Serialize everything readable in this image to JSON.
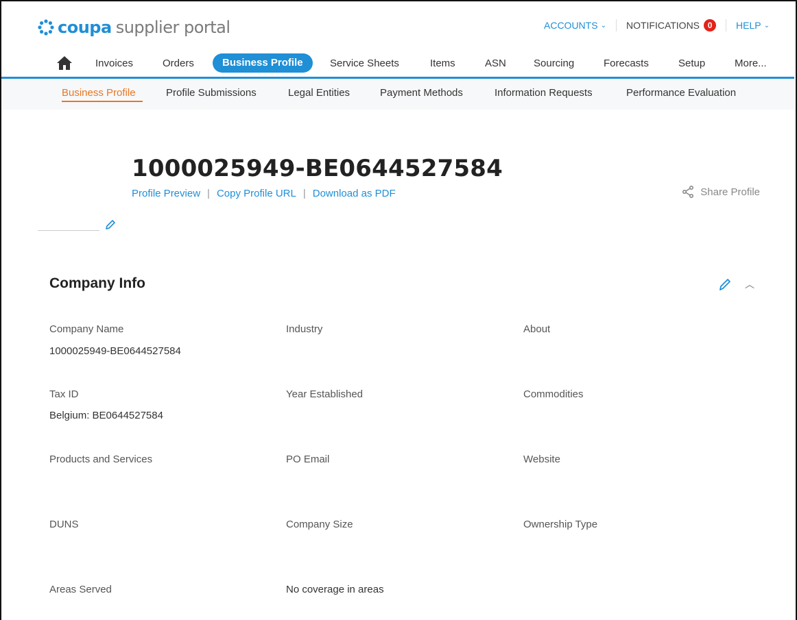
{
  "header": {
    "logo_brand": "coupa",
    "logo_rest": "supplier portal",
    "accounts_label": "ACCOUNTS",
    "notifications_label": "NOTIFICATIONS",
    "notifications_count": "0",
    "help_label": "HELP"
  },
  "nav": {
    "items": [
      "Invoices",
      "Orders",
      "Business Profile",
      "Service Sheets",
      "Items",
      "ASN",
      "Sourcing",
      "Forecasts",
      "Setup",
      "More..."
    ],
    "active": "Business Profile"
  },
  "subnav": {
    "items": [
      "Business Profile",
      "Profile Submissions",
      "Legal Entities",
      "Payment Methods",
      "Information Requests",
      "Performance Evaluation"
    ],
    "active": "Business Profile"
  },
  "profile": {
    "title": "1000025949-BE0644527584",
    "links": [
      "Profile Preview",
      "Copy Profile URL",
      "Download as PDF"
    ],
    "share_label": "Share Profile"
  },
  "company_info": {
    "title": "Company Info",
    "fields": {
      "company_name": {
        "label": "Company Name",
        "value": "1000025949-BE0644527584"
      },
      "industry": {
        "label": "Industry",
        "value": ""
      },
      "about": {
        "label": "About",
        "value": ""
      },
      "tax_id": {
        "label": "Tax ID",
        "value": "Belgium: BE0644527584"
      },
      "year_established": {
        "label": "Year Established",
        "value": ""
      },
      "commodities": {
        "label": "Commodities",
        "value": ""
      },
      "products_services": {
        "label": "Products and Services",
        "value": ""
      },
      "po_email": {
        "label": "PO Email",
        "value": ""
      },
      "website": {
        "label": "Website",
        "value": ""
      },
      "duns": {
        "label": "DUNS",
        "value": ""
      },
      "company_size": {
        "label": "Company Size",
        "value": ""
      },
      "ownership_type": {
        "label": "Ownership Type",
        "value": ""
      },
      "areas_served": {
        "label": "Areas Served",
        "value": "No coverage in areas"
      }
    }
  },
  "colors": {
    "brand_blue": "#1f8fd6",
    "active_orange": "#e87722",
    "badge_red": "#e2231a"
  }
}
